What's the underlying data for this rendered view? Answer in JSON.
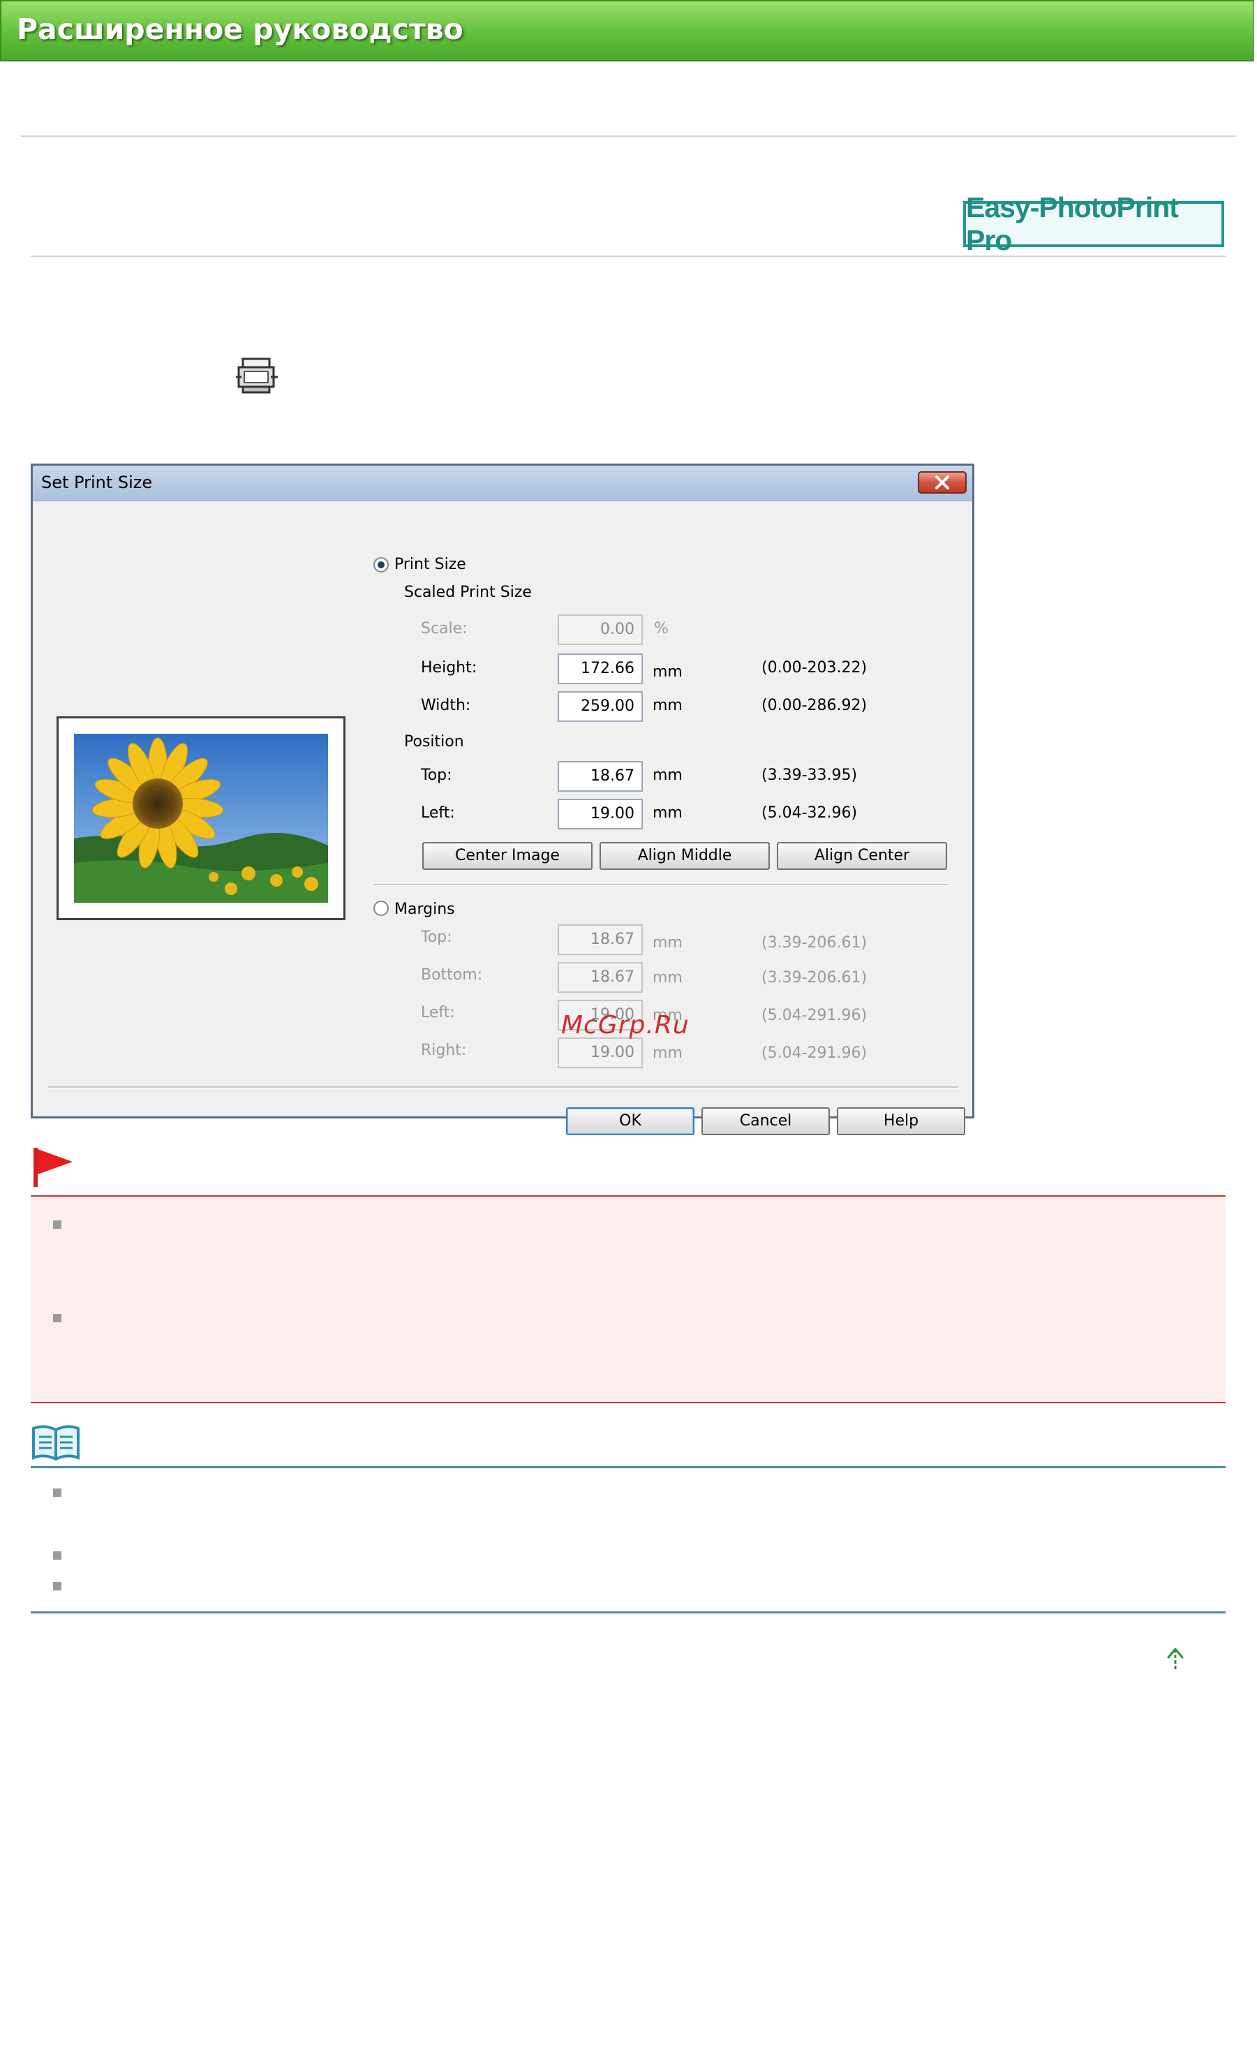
{
  "header": {
    "title": "Расширенное руководство",
    "colors": {
      "banner": "#62c03c",
      "banner_text": "#ffffff"
    }
  },
  "app_badge": {
    "label": "Easy-PhotoPrint Pro",
    "color": "#1f8e86"
  },
  "toolbar_icon": {
    "icon": "set-print-size-icon"
  },
  "dialog": {
    "title": "Set Print Size",
    "close_icon": "close-icon",
    "print_size": {
      "radio_label": "Print Size",
      "selected": true,
      "scaled_group_label": "Scaled Print Size",
      "scale": {
        "label": "Scale:",
        "value": "0.00",
        "unit": "%"
      },
      "height": {
        "label": "Height:",
        "value": "172.66",
        "unit": "mm",
        "range": "(0.00-203.22)"
      },
      "width": {
        "label": "Width:",
        "value": "259.00",
        "unit": "mm",
        "range": "(0.00-286.92)"
      },
      "position_group_label": "Position",
      "top": {
        "label": "Top:",
        "value": "18.67",
        "unit": "mm",
        "range": "(3.39-33.95)"
      },
      "left": {
        "label": "Left:",
        "value": "19.00",
        "unit": "mm",
        "range": "(5.04-32.96)"
      },
      "buttons": {
        "center_image": "Center Image",
        "align_middle": "Align Middle",
        "align_center": "Align Center"
      }
    },
    "margins": {
      "radio_label": "Margins",
      "selected": false,
      "top": {
        "label": "Top:",
        "value": "18.67",
        "unit": "mm",
        "range": "(3.39-206.61)"
      },
      "bottom": {
        "label": "Bottom:",
        "value": "18.67",
        "unit": "mm",
        "range": "(3.39-206.61)"
      },
      "left": {
        "label": "Left:",
        "value": "19.00",
        "unit": "mm",
        "range": "(5.04-291.96)"
      },
      "right": {
        "label": "Right:",
        "value": "19.00",
        "unit": "mm",
        "range": "(5.04-291.96)"
      }
    },
    "footer_buttons": {
      "ok": "OK",
      "cancel": "Cancel",
      "help": "Help"
    }
  },
  "watermark": "McGrp.Ru",
  "important": {
    "icon": "red-flag-icon",
    "colors": {
      "border": "#c13a3a",
      "background": "#fdeeee"
    }
  },
  "note": {
    "icon": "open-book-icon",
    "colors": {
      "rule": "#4a8f98"
    }
  },
  "top_link": {
    "icon": "arrow-up-icon"
  }
}
